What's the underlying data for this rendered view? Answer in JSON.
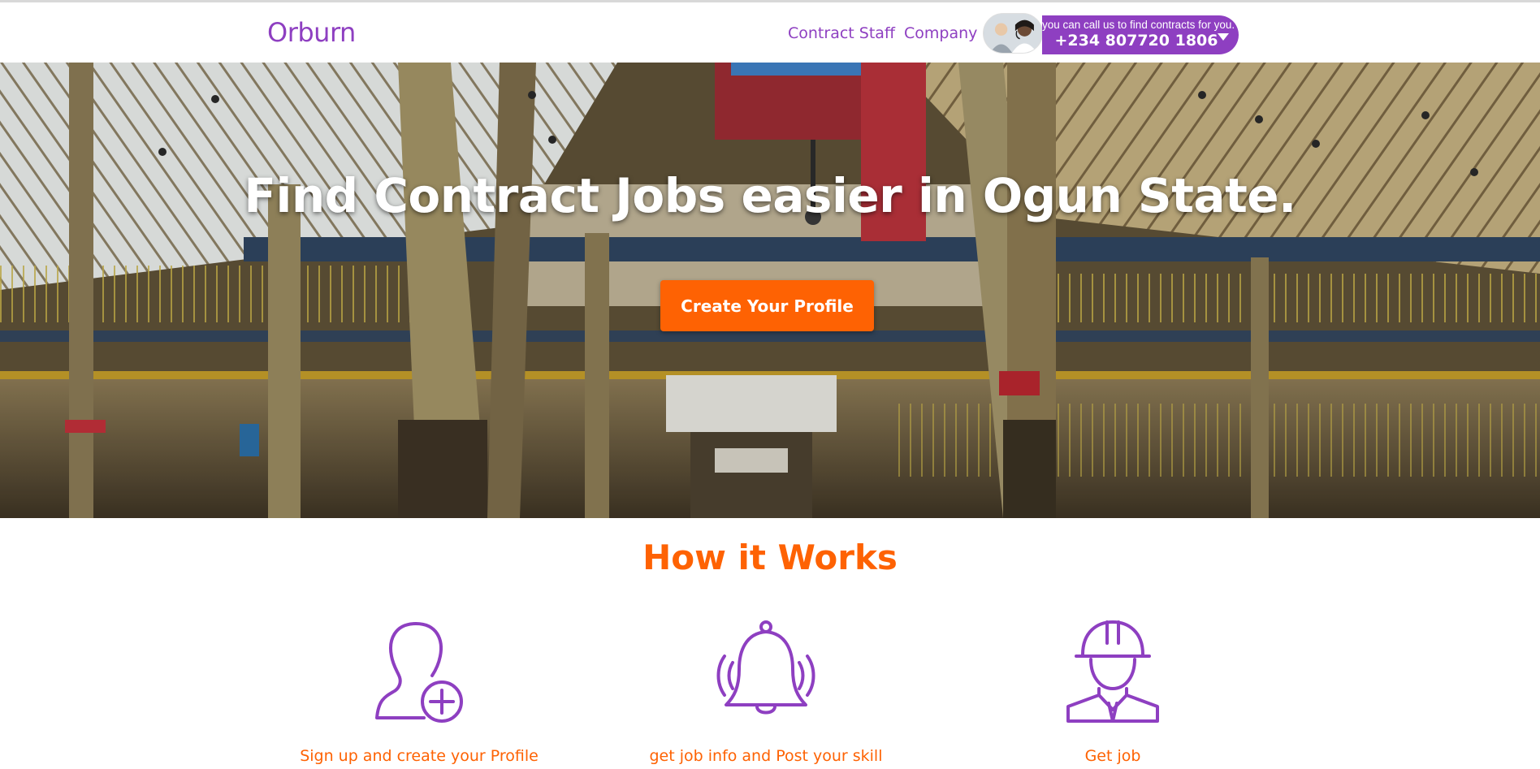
{
  "brand": {
    "name": "Orburn",
    "color": "#8e3fc1"
  },
  "nav": {
    "links": [
      {
        "label": "Contract Staff"
      },
      {
        "label": "Company"
      }
    ]
  },
  "contact": {
    "tagline": "you can call us to find contracts for you.",
    "phone": "+234 807720 1806",
    "icon": "caret-down-icon"
  },
  "hero": {
    "title": "Find Contract Jobs easier in Ogun State.",
    "cta_label": "Create Your Profile",
    "cta_color": "#fe6203"
  },
  "how_it_works": {
    "title": "How it Works",
    "steps": [
      {
        "label": "Sign up and create your Profile",
        "icon": "add-user-icon"
      },
      {
        "label": "get job info and Post your skill",
        "icon": "bell-icon"
      },
      {
        "label": "Get job",
        "icon": "worker-helmet-icon"
      }
    ]
  },
  "colors": {
    "accent": "#fe6203",
    "brand": "#8e3fc1"
  }
}
